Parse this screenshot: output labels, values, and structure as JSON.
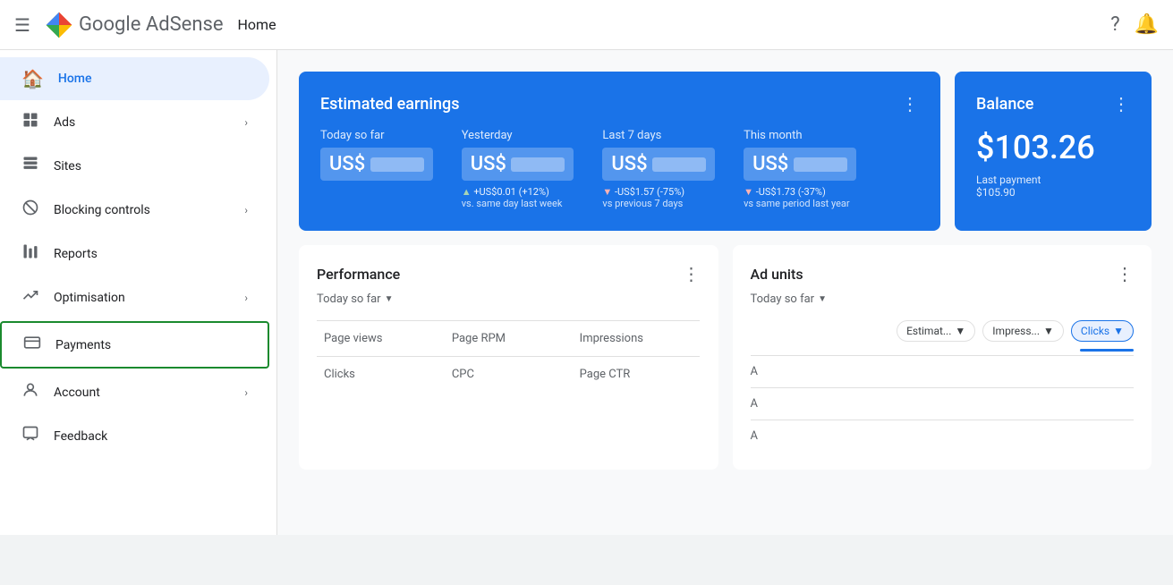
{
  "topbar": {
    "menu_icon": "☰",
    "logo_alt": "Google AdSense",
    "page_title": "Home",
    "help_icon": "?",
    "bell_icon": "🔔"
  },
  "sidebar": {
    "items": [
      {
        "id": "home",
        "label": "Home",
        "icon": "⌂",
        "active": true,
        "expandable": false
      },
      {
        "id": "ads",
        "label": "Ads",
        "icon": "▣",
        "active": false,
        "expandable": true
      },
      {
        "id": "sites",
        "label": "Sites",
        "icon": "▤",
        "active": false,
        "expandable": false
      },
      {
        "id": "blocking-controls",
        "label": "Blocking controls",
        "icon": "⊘",
        "active": false,
        "expandable": true
      },
      {
        "id": "reports",
        "label": "Reports",
        "icon": "▦",
        "active": false,
        "expandable": false
      },
      {
        "id": "optimisation",
        "label": "Optimisation",
        "icon": "↗",
        "active": false,
        "expandable": true
      },
      {
        "id": "payments",
        "label": "Payments",
        "icon": "⊡",
        "active": false,
        "expandable": false,
        "highlighted": true
      },
      {
        "id": "account",
        "label": "Account",
        "icon": "⚙",
        "active": false,
        "expandable": true
      },
      {
        "id": "feedback",
        "label": "Feedback",
        "icon": "⊟",
        "active": false,
        "expandable": false
      }
    ]
  },
  "earnings_card": {
    "title": "Estimated earnings",
    "menu_icon": "⋮",
    "periods": [
      {
        "label": "Today so far",
        "prefix": "US$",
        "value_masked": true,
        "change": null
      },
      {
        "label": "Yesterday",
        "prefix": "US$",
        "value_masked": true,
        "change": "+US$0.01 (+12%)",
        "change_note": "vs. same day last week",
        "direction": "up"
      },
      {
        "label": "Last 7 days",
        "prefix": "US$",
        "value_masked": true,
        "change": "-US$1.57 (-75%)",
        "change_note": "vs previous 7 days",
        "direction": "down"
      },
      {
        "label": "This month",
        "prefix": "US$",
        "value_masked": true,
        "change": "-US$1.73 (-37%)",
        "change_note": "vs same period last year",
        "direction": "down"
      }
    ]
  },
  "balance_card": {
    "title": "Balance",
    "menu_icon": "⋮",
    "amount": "$103.26",
    "last_payment_label": "Last payment",
    "last_payment_amount": "$105.90"
  },
  "performance_panel": {
    "title": "Performance",
    "menu_icon": "⋮",
    "period": "Today so far",
    "metrics": [
      {
        "label": "Page views"
      },
      {
        "label": "Page RPM"
      },
      {
        "label": "Impressions"
      },
      {
        "label": "Clicks"
      },
      {
        "label": "CPC"
      },
      {
        "label": "Page CTR"
      }
    ]
  },
  "ad_units_panel": {
    "title": "Ad units",
    "menu_icon": "⋮",
    "period": "Today so far",
    "filters": [
      {
        "label": "Estimat...",
        "active": false
      },
      {
        "label": "Impress...",
        "active": false
      },
      {
        "label": "Clicks",
        "active": true
      }
    ],
    "rows": [
      {
        "label": "A"
      },
      {
        "label": "A"
      },
      {
        "label": "A"
      }
    ]
  }
}
